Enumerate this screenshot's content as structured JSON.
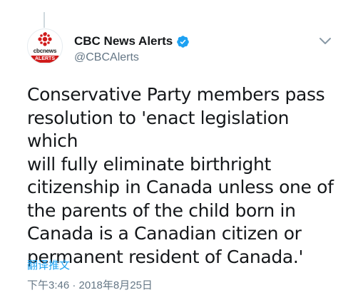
{
  "account": {
    "display_name": "CBC News Alerts",
    "handle": "@CBCAlerts",
    "avatar_word": "cbcnews",
    "avatar_badge": "ALERTS",
    "brand_color": "#d01b1b",
    "verified_color": "#1da1f2"
  },
  "tweet": {
    "text": "Conservative Party members pass\nresolution to 'enact legislation which\nwill fully eliminate birthright\ncitizenship in Canada unless one of\nthe parents of the child born in\nCanada is a Canadian citizen or\npermanent resident of Canada.'",
    "translate_label": "翻译推文",
    "timestamp": "下午3:46 · 2018年8月25日"
  },
  "icons": {
    "verified": "verified-badge-icon",
    "caret": "chevron-down-icon",
    "logo": "cbc-gem-logo-icon"
  }
}
